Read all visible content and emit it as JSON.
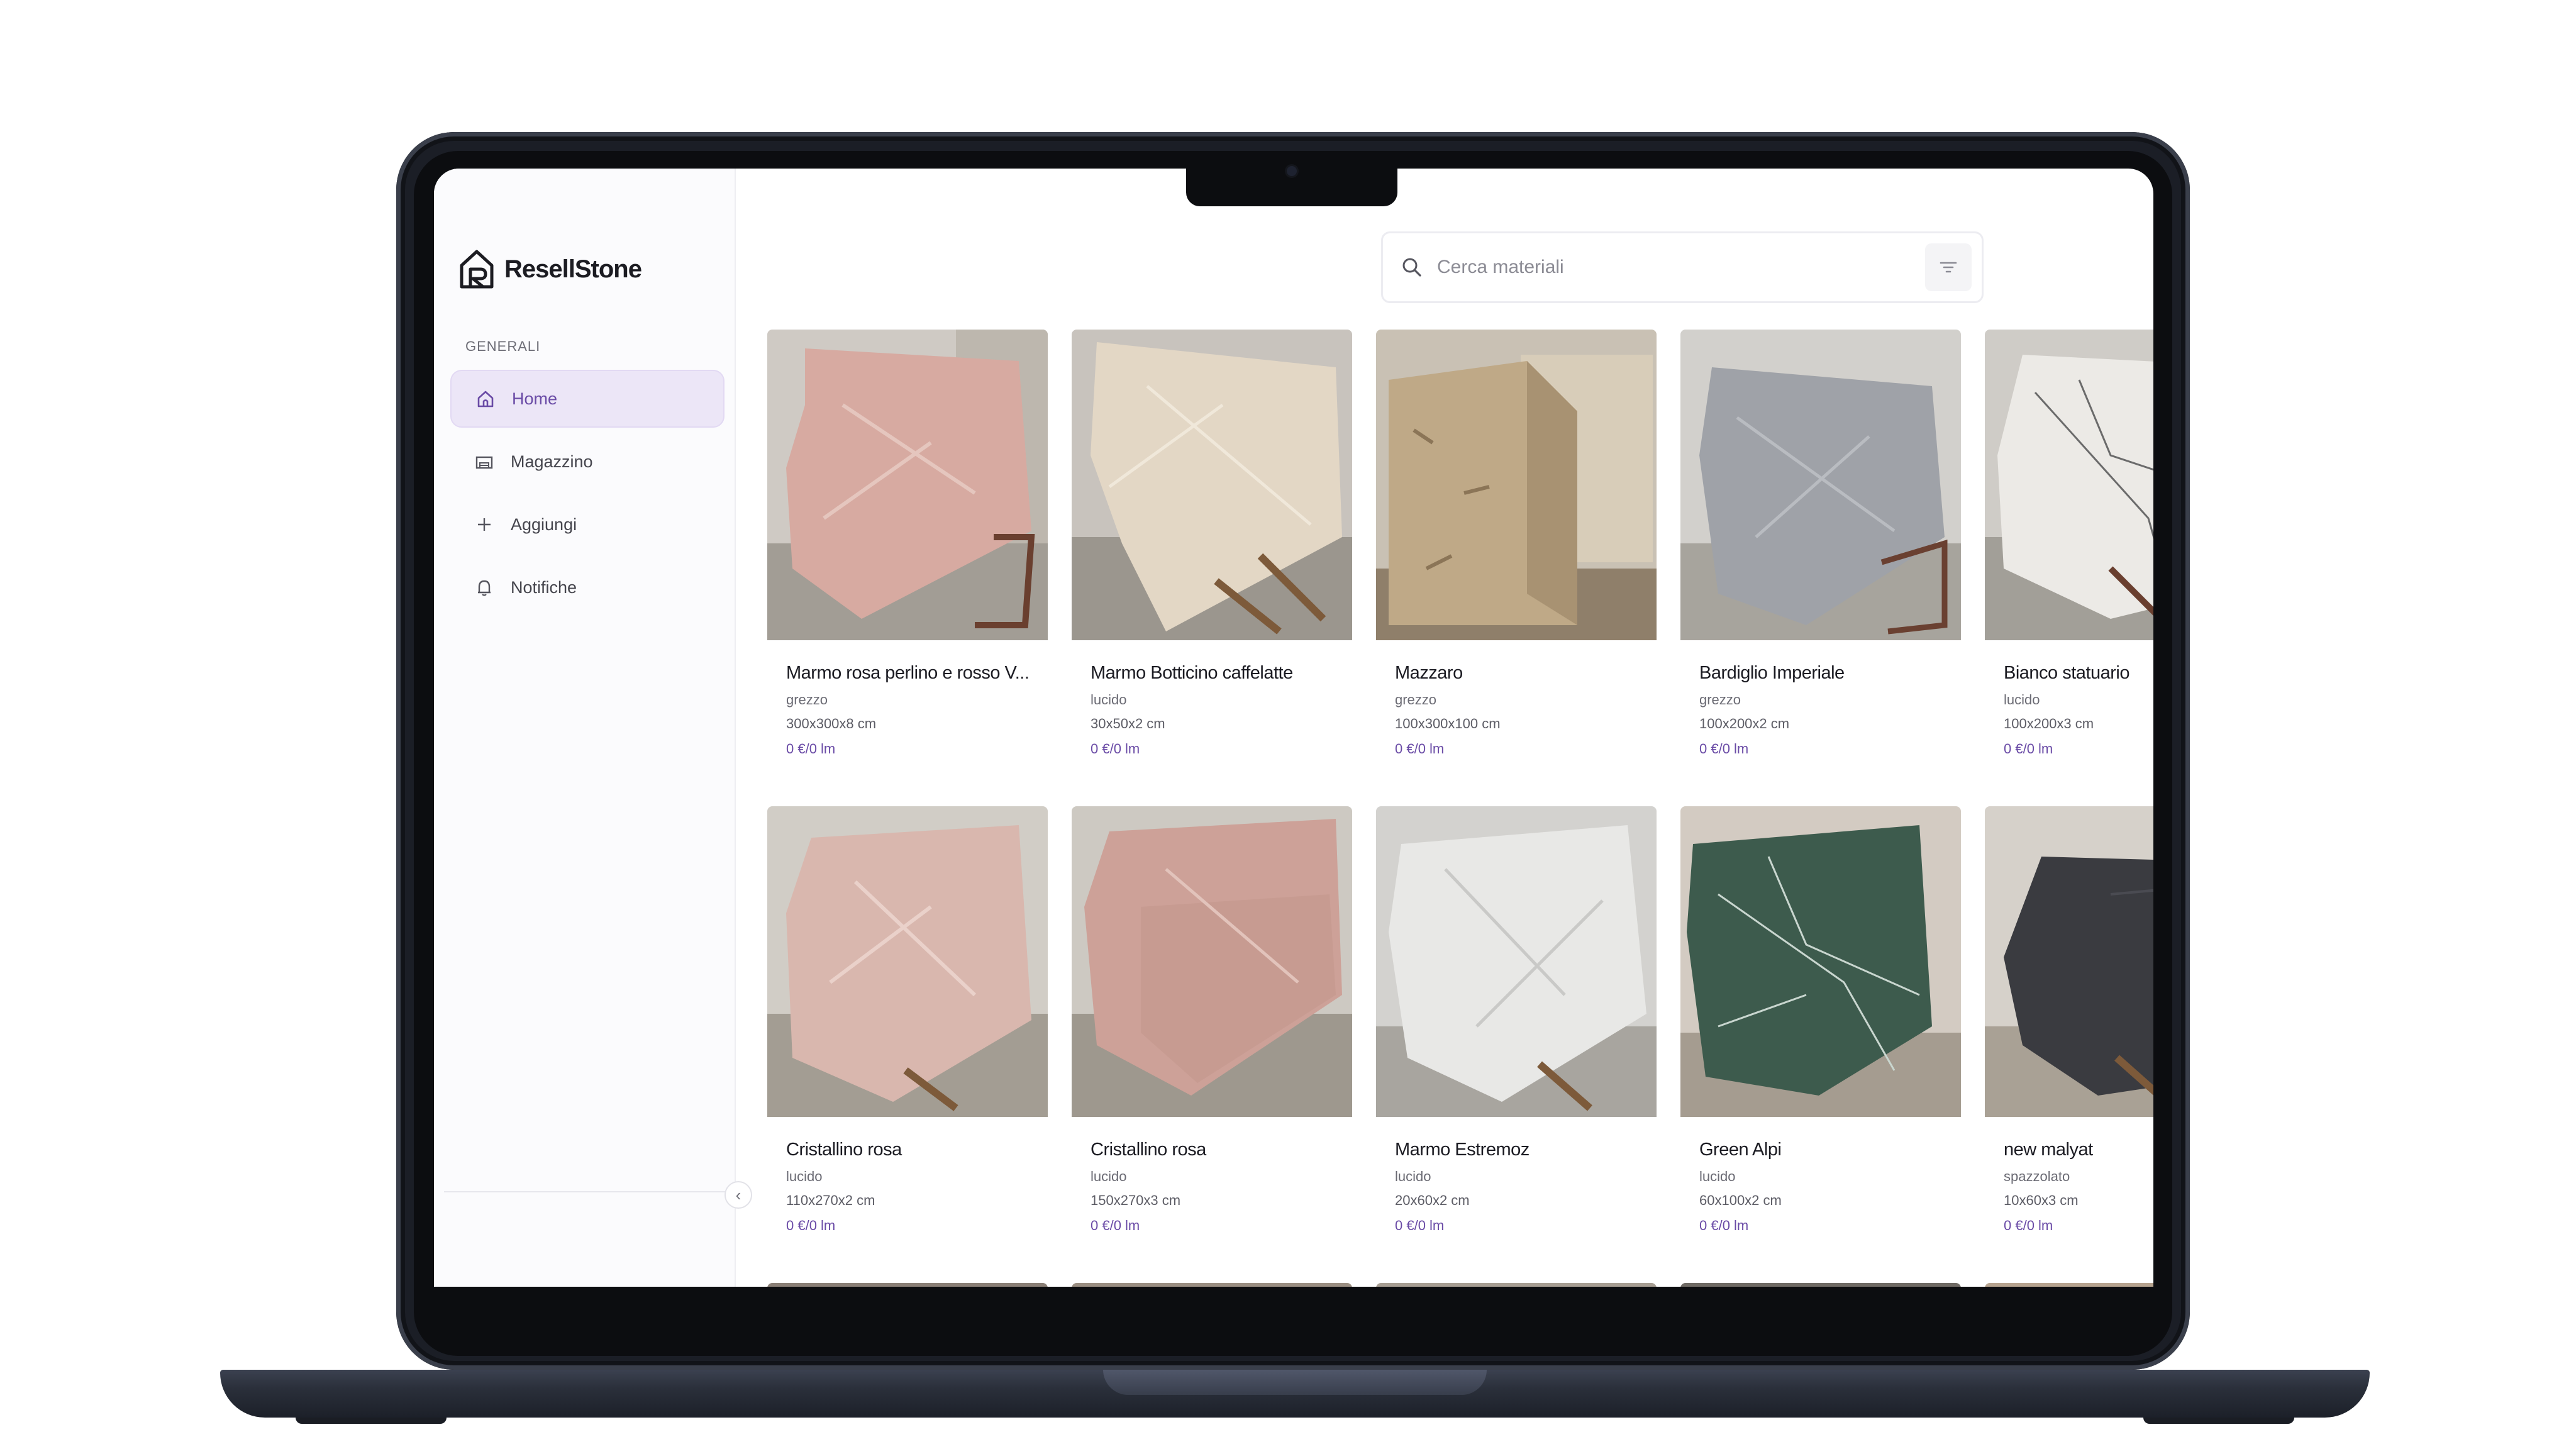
{
  "app": {
    "name": "ResellStone"
  },
  "sidebar": {
    "section_label": "GENERALI",
    "items": [
      {
        "label": "Home",
        "icon": "home-icon",
        "active": true
      },
      {
        "label": "Magazzino",
        "icon": "warehouse-icon",
        "active": false
      },
      {
        "label": "Aggiungi",
        "icon": "plus-icon",
        "active": false
      },
      {
        "label": "Notifiche",
        "icon": "bell-icon",
        "active": false
      }
    ],
    "collapse_icon": "chevron-left-icon"
  },
  "search": {
    "placeholder": "Cerca materiali",
    "filter_icon": "filter-icon"
  },
  "colors": {
    "accent": "#6a4ba6",
    "active_bg": "#ece6f7",
    "frame": "#1b1e26"
  },
  "products": [
    {
      "title": "Marmo rosa perlino e rosso V...",
      "finish": "grezzo",
      "dims": "300x300x8 cm",
      "price": "0 €/0 lm"
    },
    {
      "title": "Marmo Botticino caffelatte",
      "finish": "lucido",
      "dims": "30x50x2 cm",
      "price": "0 €/0 lm"
    },
    {
      "title": "Mazzaro",
      "finish": "grezzo",
      "dims": "100x300x100 cm",
      "price": "0 €/0 lm"
    },
    {
      "title": "Bardiglio Imperiale",
      "finish": "grezzo",
      "dims": "100x200x2 cm",
      "price": "0 €/0 lm"
    },
    {
      "title": "Bianco statuario",
      "finish": "lucido",
      "dims": "100x200x3 cm",
      "price": "0 €/0 lm"
    },
    {
      "title": "Cristallino rosa",
      "finish": "lucido",
      "dims": "110x270x2 cm",
      "price": "0 €/0 lm"
    },
    {
      "title": "Cristallino rosa",
      "finish": "lucido",
      "dims": "150x270x3 cm",
      "price": "0 €/0 lm"
    },
    {
      "title": "Marmo Estremoz",
      "finish": "lucido",
      "dims": "20x60x2 cm",
      "price": "0 €/0 lm"
    },
    {
      "title": "Green Alpi",
      "finish": "lucido",
      "dims": "60x100x2 cm",
      "price": "0 €/0 lm"
    },
    {
      "title": "new malyat",
      "finish": "spazzolato",
      "dims": "10x60x3 cm",
      "price": "0 €/0 lm"
    }
  ]
}
